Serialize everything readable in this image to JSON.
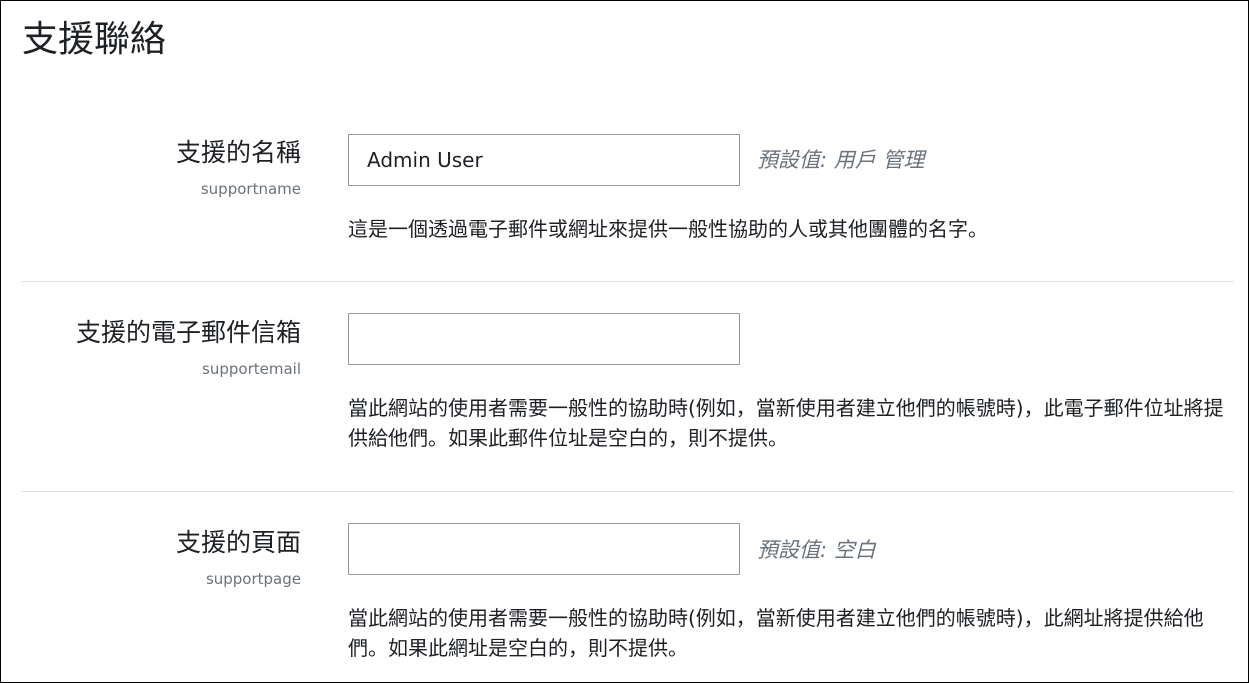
{
  "page": {
    "title": "支援聯絡"
  },
  "settings": [
    {
      "label": "支援的名稱",
      "key": "supportname",
      "value": "Admin User",
      "default": "預設值: 用戶 管理",
      "description": "這是一個透過電子郵件或網址來提供一般性協助的人或其他團體的名字。"
    },
    {
      "label": "支援的電子郵件信箱",
      "key": "supportemail",
      "value": "",
      "default": "",
      "description": "當此網站的使用者需要一般性的協助時(例如，當新使用者建立他們的帳號時)，此電子郵件位址將提供給他們。如果此郵件位址是空白的，則不提供。"
    },
    {
      "label": "支援的頁面",
      "key": "supportpage",
      "value": "",
      "default": "預設值: 空白",
      "description": "當此網站的使用者需要一般性的協助時(例如，當新使用者建立他們的帳號時)，此網址將提供給他們。如果此網址是空白的，則不提供。"
    }
  ]
}
